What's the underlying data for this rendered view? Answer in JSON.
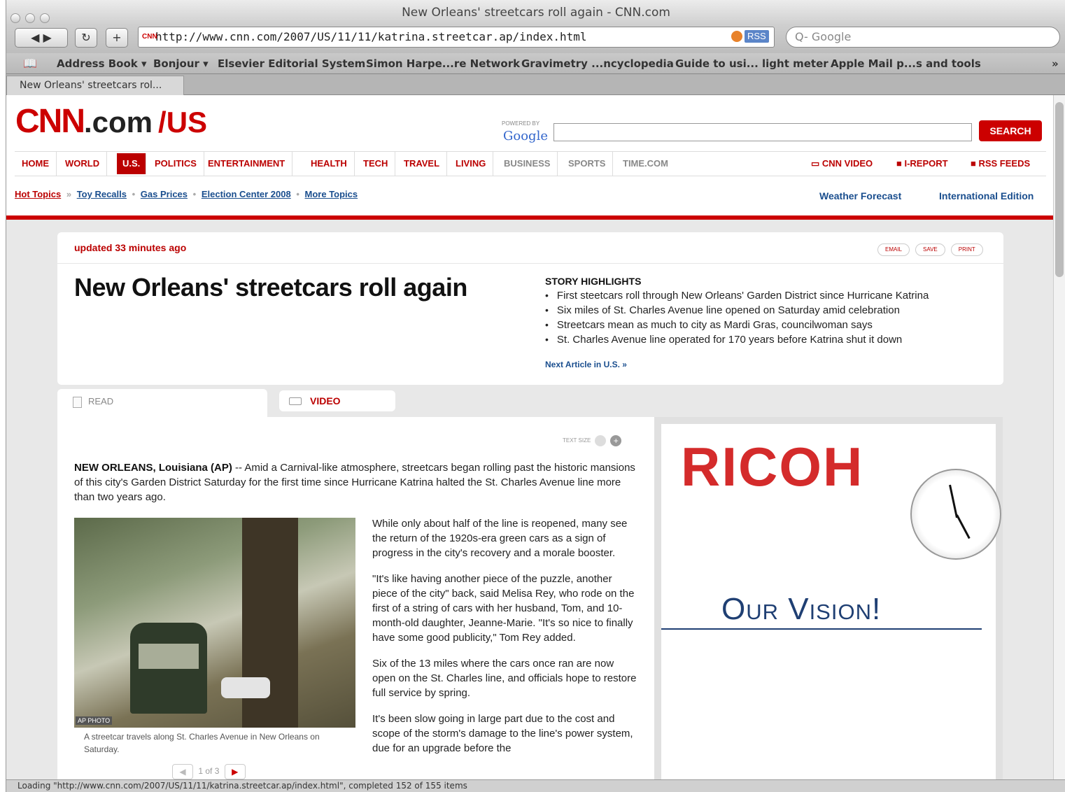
{
  "window": {
    "title": "New Orleans' streetcars roll again - CNN.com"
  },
  "toolbar": {
    "back": "◀ ▶",
    "reload": "↻",
    "add": "+",
    "url": "http://www.cnn.com/2007/US/11/11/katrina.streetcar.ap/index.html",
    "url_favicon": "CNN",
    "rss": "RSS",
    "search_placeholder": "Q- Google"
  },
  "bookmarks": [
    "Address Book ▾",
    "Bonjour ▾",
    "Elsevier Editorial System",
    "Simon Harpe...re Network",
    "Gravimetry ...ncyclopedia",
    "Guide to usi... light meter",
    "Apple Mail p...s and tools"
  ],
  "bookmarks_more": "»",
  "tab": {
    "label": "New Orleans' streetcars rol..."
  },
  "site": {
    "logo": "CNN",
    "logo_dotcom": ".com",
    "logo_section": "/US",
    "powered_by": "POWERED BY",
    "google": "Google",
    "search_button": "SEARCH",
    "nav": [
      "HOME",
      "WORLD",
      "U.S.",
      "POLITICS",
      "ENTERTAINMENT",
      "HEALTH",
      "TECH",
      "TRAVEL",
      "LIVING",
      "BUSINESS",
      "SPORTS",
      "TIME.COM"
    ],
    "nav_right": {
      "video": "CNN VIDEO",
      "ireport": "I-REPORT",
      "rss": "RSS FEEDS"
    },
    "subnav": {
      "hot": "Hot Topics",
      "arrow": "»",
      "items": [
        "Toy Recalls",
        "Gas Prices",
        "Election Center 2008",
        "More Topics"
      ],
      "sep": "•"
    },
    "weather": "Weather Forecast",
    "intl": "International Edition"
  },
  "story": {
    "updated": "updated 33 minutes ago",
    "actions": [
      "EMAIL",
      "SAVE",
      "PRINT"
    ],
    "headline": "New Orleans' streetcars roll again",
    "highlights_title": "STORY HIGHLIGHTS",
    "highlights": [
      "First steetcars roll through New Orleans' Garden District since Hurricane Katrina",
      "Six miles of St. Charles Avenue line opened on Saturday amid celebration",
      "Streetcars mean as much to city as Mardi Gras, councilwoman says",
      "St. Charles Avenue line operated for 170 years before Katrina shut it down"
    ],
    "next_article": "Next Article in U.S. »",
    "tab_read": "READ",
    "tab_video": "VIDEO",
    "text_size": "TEXT SIZE",
    "text_size_plus": "+",
    "dateline": "NEW ORLEANS, Louisiana (AP)",
    "lede": " -- Amid a Carnival-like atmosphere, streetcars began rolling past the historic mansions of this city's Garden District Saturday for the first time since Hurricane Katrina halted the St. Charles Avenue line more than two years ago.",
    "photo_credit": "AP PHOTO",
    "caption": "A streetcar travels along St. Charles Avenue in New Orleans on Saturday.",
    "pager": "1 of 3",
    "pager_prev": "◀",
    "pager_next": "▶",
    "paragraphs": [
      "While only about half of the line is reopened, many see the return of the 1920s-era green cars as a sign of progress in the city's recovery and a morale booster.",
      "\"It's like having another piece of the puzzle, another piece of the city\" back, said Melisa Rey, who rode on the first of a string of cars with her husband, Tom, and 10-month-old daughter, Jeanne-Marie. \"It's so nice to finally have some good publicity,\" Tom Rey added.",
      "Six of the 13 miles where the cars once ran are now open on the St. Charles line, and officials hope to restore full service by spring.",
      "It's been slow going in large part due to the cost and scope of the storm's damage to the line's power system, due for an upgrade before the"
    ]
  },
  "ad": {
    "brand": "RICOH",
    "tagline": "Our Vision!"
  },
  "status": "Loading \"http://www.cnn.com/2007/US/11/11/katrina.streetcar.ap/index.html\", completed 152 of 155 items"
}
